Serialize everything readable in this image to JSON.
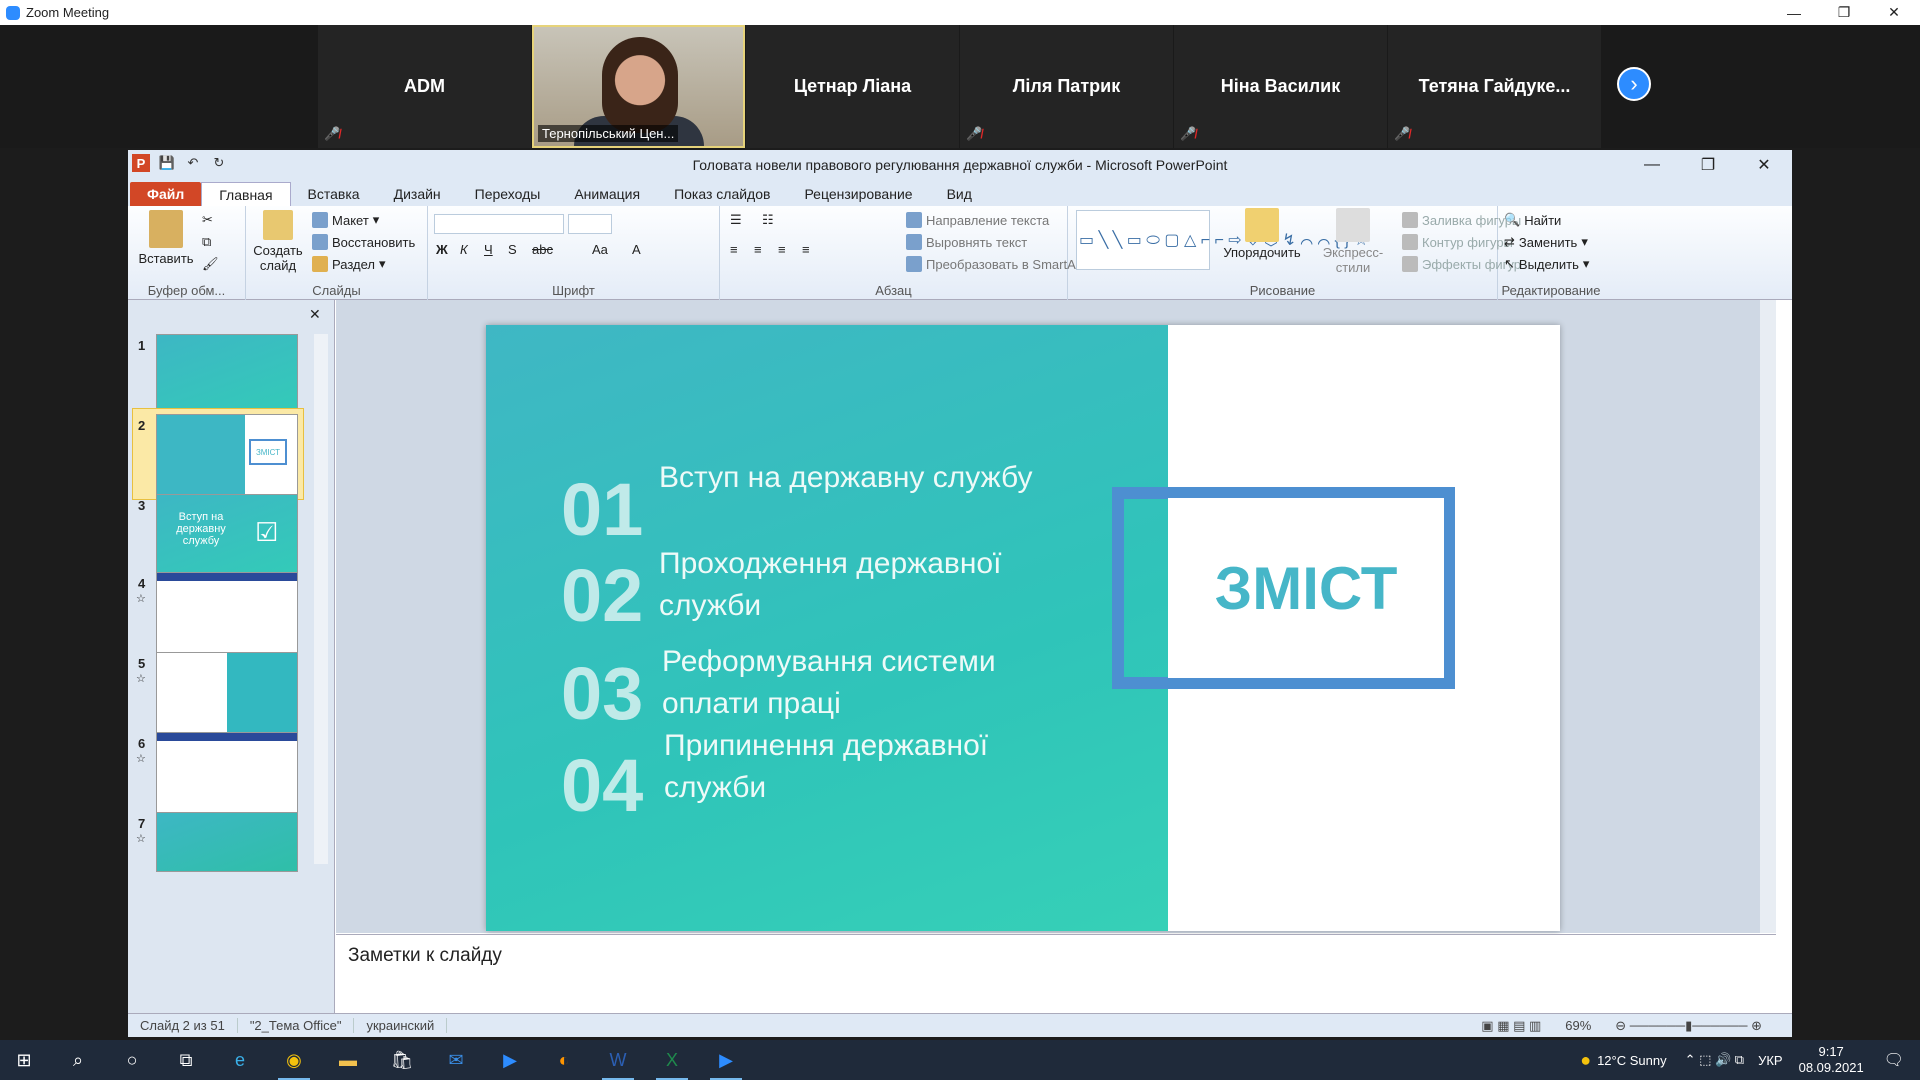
{
  "zoom": {
    "window_title": "Zoom Meeting",
    "controls": [
      "—",
      "❐",
      "✕"
    ],
    "participants": [
      {
        "name": "ADM"
      },
      {
        "name": "Тернопільський Цен...",
        "video": true
      },
      {
        "name": "Цетнар Ліана"
      },
      {
        "name": "Ліля Патрик"
      },
      {
        "name": "Ніна Василик"
      },
      {
        "name": "Тетяна Гайдуке..."
      }
    ],
    "next_icon": "›"
  },
  "ppt": {
    "title": "Головата новели правового регулювання державної служби  -  Microsoft PowerPoint",
    "tabs": [
      "Файл",
      "Главная",
      "Вставка",
      "Дизайн",
      "Переходы",
      "Анимация",
      "Показ слайдов",
      "Рецензирование",
      "Вид"
    ],
    "active_tab": "Главная",
    "ribbon": {
      "clipboard": {
        "label": "Буфер обм...",
        "paste": "Вставить"
      },
      "slides": {
        "label": "Слайды",
        "new_slide": "Создать слайд",
        "layout": "Макет",
        "reset": "Восстановить",
        "section": "Раздел"
      },
      "font": {
        "label": "Шрифт"
      },
      "paragraph": {
        "label": "Абзац",
        "text_direction": "Направление текста",
        "align_text": "Выровнять текст",
        "smartart": "Преобразовать в SmartArt"
      },
      "drawing": {
        "label": "Рисование",
        "arrange": "Упорядочить",
        "quick_styles": "Экспресс-стили",
        "fill": "Заливка фигуры",
        "outline": "Контур фигуры",
        "effects": "Эффекты фигур"
      },
      "editing": {
        "label": "Редактирование",
        "find": "Найти",
        "replace": "Заменить",
        "select": "Выделить"
      }
    },
    "thumbnails": [
      "1",
      "2",
      "3",
      "4",
      "5",
      "6",
      "7"
    ],
    "thumb3_text": "Вступ на державну службу",
    "thumb2_text": "ЗМІСТ",
    "slide": {
      "items": [
        {
          "num": "01",
          "text": "Вступ на державну службу"
        },
        {
          "num": "02",
          "text": "Проходження державної служби"
        },
        {
          "num": "03",
          "text": "Реформування системи оплати праці"
        },
        {
          "num": "04",
          "text": "Припинення державної служби"
        }
      ],
      "heading": "ЗМІСТ"
    },
    "notes_placeholder": "Заметки к слайду",
    "status": {
      "slide": "Слайд 2 из 51",
      "theme": "\"2_Тема Office\"",
      "lang": "украинский",
      "zoom": "69%"
    }
  },
  "taskbar": {
    "weather": "12°C  Sunny",
    "lang": "УКР",
    "time": "9:17",
    "date": "08.09.2021"
  },
  "colors": {
    "accent": "#2d8cff",
    "slide_teal": "#36c4b9",
    "frame_blue": "#4d8fd1",
    "heading": "#46b6c8"
  }
}
